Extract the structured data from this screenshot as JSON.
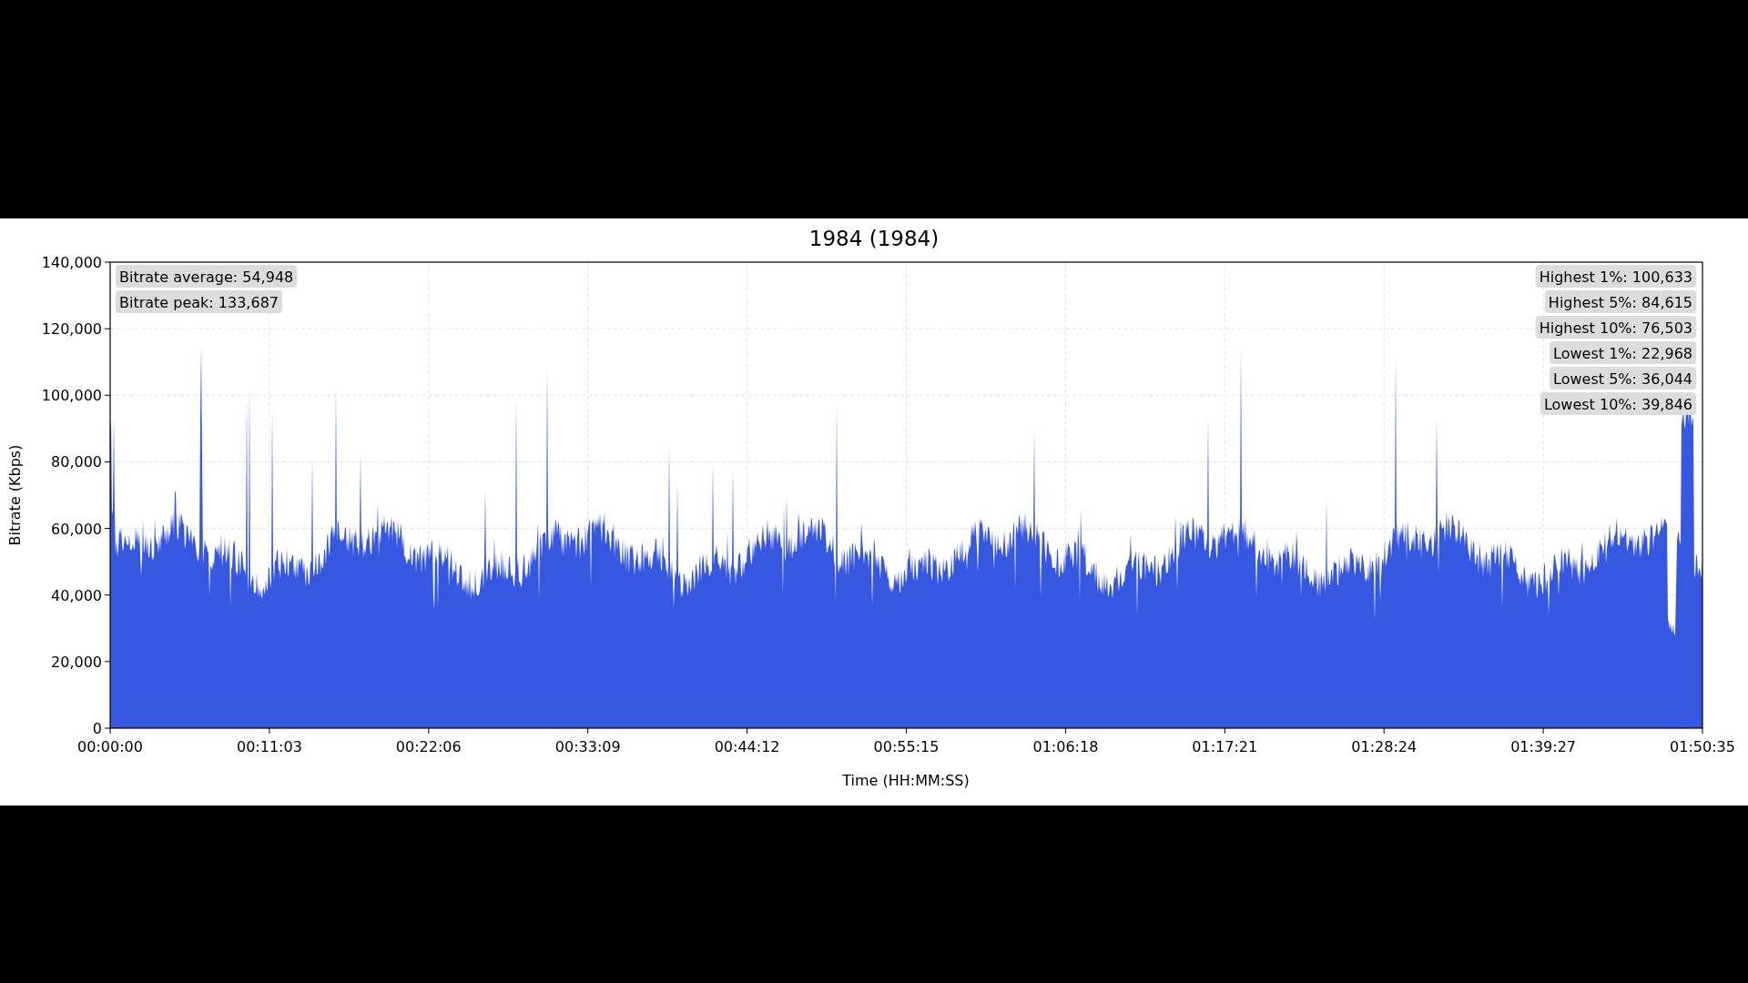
{
  "title": "1984 (1984)",
  "chart": {
    "ylabel": "Bitrate (Kbps)",
    "xlabel": "Time (HH:MM:SS)",
    "yticks": [
      "140,000",
      "120,000",
      "100,000",
      "80,000",
      "60,000",
      "40,000",
      "20,000",
      "0"
    ],
    "xticks": [
      "00:00:00",
      "00:11:03",
      "00:22:06",
      "00:33:09",
      "00:44:12",
      "00:55:15",
      "01:06:18",
      "01:17:21",
      "01:28:24",
      "01:39:27",
      "01:50:35"
    ],
    "stats_left": [
      "Bitrate average: 54,948",
      "Bitrate peak: 133,687"
    ],
    "stats_right": [
      "Highest 1%: 100,633",
      "Highest 5%: 84,615",
      "Highest 10%: 76,503",
      "Lowest 1%: 22,968",
      "Lowest 5%: 36,044",
      "Lowest 10%: 39,846"
    ]
  }
}
